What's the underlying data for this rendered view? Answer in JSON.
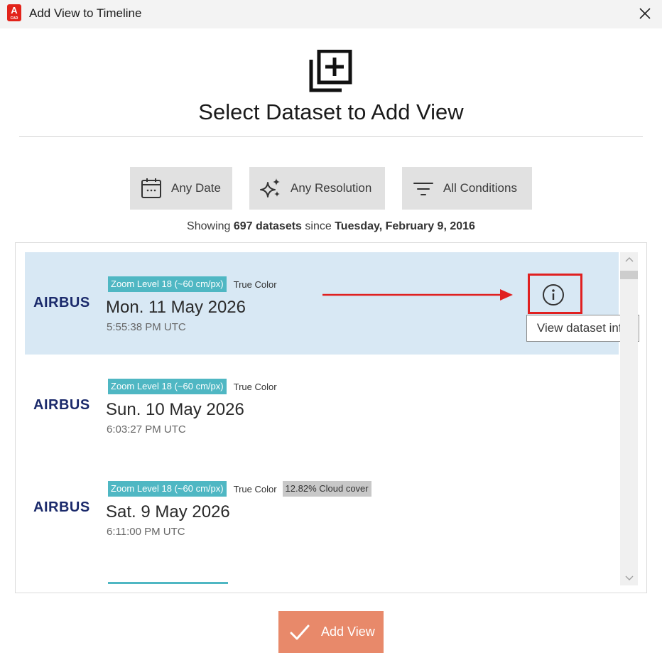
{
  "window": {
    "app_icon_letter": "A",
    "app_icon_sub": "CAD",
    "title": "Add View to Timeline"
  },
  "header": {
    "title": "Select Dataset to Add View",
    "icon": "add-to-stack-icon"
  },
  "filters": [
    {
      "label": "Any Date",
      "icon": "calendar-icon"
    },
    {
      "label": "Any Resolution",
      "icon": "sparkle-icon"
    },
    {
      "label": "All Conditions",
      "icon": "filter-icon"
    }
  ],
  "summary": {
    "prefix": "Showing",
    "count": "697 datasets",
    "middle": "since",
    "date": "Tuesday, February 9, 2016"
  },
  "datasets": [
    {
      "provider": "AIRBUS",
      "zoom_tag": "Zoom Level 18 (~60 cm/px)",
      "color_tag": "True Color",
      "cloud_tag": "",
      "date": "Mon. 11 May 2026",
      "time": "5:55:38 PM UTC",
      "selected": true
    },
    {
      "provider": "AIRBUS",
      "zoom_tag": "Zoom Level 18 (~60 cm/px)",
      "color_tag": "True Color",
      "cloud_tag": "",
      "date": "Sun. 10 May 2026",
      "time": "6:03:27 PM UTC",
      "selected": false
    },
    {
      "provider": "AIRBUS",
      "zoom_tag": "Zoom Level 18 (~60 cm/px)",
      "color_tag": "True Color",
      "cloud_tag": "12.82% Cloud cover",
      "date": "Sat. 9 May 2026",
      "time": "6:11:00 PM UTC",
      "selected": false
    }
  ],
  "tooltip": {
    "text": "View dataset info"
  },
  "actions": {
    "add_view_label": "Add View"
  },
  "colors": {
    "selected_row": "#d8e8f4",
    "zoom_tag": "#4fb7c3",
    "cloud_tag": "#c8c8c8",
    "highlight": "#e02020",
    "add_view_button": "#e8896a",
    "airbus_logo": "#1b2a6b"
  }
}
